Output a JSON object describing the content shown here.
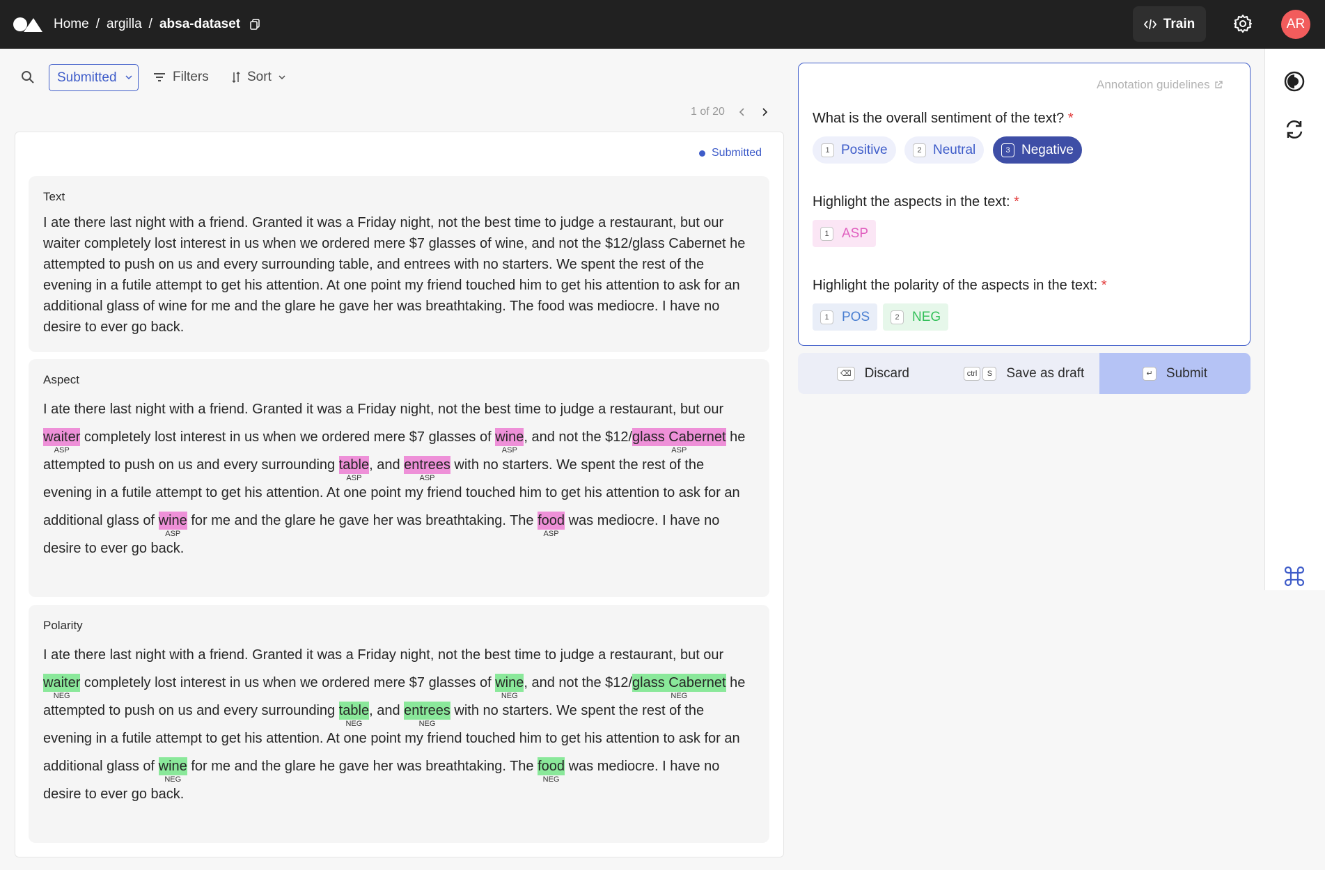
{
  "header": {
    "breadcrumbs": [
      "Home",
      "argilla",
      "absa-dataset"
    ],
    "separator": "/",
    "train_label": "Train",
    "avatar_initials": "AR"
  },
  "toolbar": {
    "status_filter": "Submitted",
    "filters_label": "Filters",
    "sort_label": "Sort",
    "pagination": "1 of 20"
  },
  "record": {
    "status": "Submitted",
    "fields": [
      {
        "label": "Text",
        "text": "I ate there last night with a friend. Granted it was a Friday night, not the best time to judge a restaurant, but our waiter completely lost interest in us when we ordered mere $7 glasses of wine, and not the $12/glass Cabernet he attempted to push on us and every surrounding table, and entrees with no starters. We spent the rest of the evening in a futile attempt to get his attention. At one point my friend touched him to get his attention to ask for an additional glass of wine for me and the glare he gave her was breathtaking. The food was mediocre. I have no desire to ever go back."
      },
      {
        "label": "Aspect",
        "segments": [
          {
            "t": "I ate there last night with a friend. Granted it was a Friday night, not the best time to judge a restaurant, but our "
          },
          {
            "t": "waiter",
            "label": "ASP"
          },
          {
            "t": " completely lost interest in us when we ordered mere $7 glasses of "
          },
          {
            "t": "wine",
            "label": "ASP"
          },
          {
            "t": ", and not the $12/"
          },
          {
            "t": "glass Cabernet",
            "label": "ASP"
          },
          {
            "t": " he attempted to push on us and every surrounding "
          },
          {
            "t": "table",
            "label": "ASP"
          },
          {
            "t": ", and "
          },
          {
            "t": "entrees",
            "label": "ASP"
          },
          {
            "t": " with no starters. We spent the rest of the evening in a futile attempt to get his attention. At one point my friend touched him to get his attention to ask for an additional glass of "
          },
          {
            "t": "wine",
            "label": "ASP"
          },
          {
            "t": " for me and the glare he gave her was breathtaking. The "
          },
          {
            "t": "food",
            "label": "ASP"
          },
          {
            "t": " was mediocre. I have no desire to ever go back."
          }
        ]
      },
      {
        "label": "Polarity",
        "segments": [
          {
            "t": "I ate there last night with a friend. Granted it was a Friday night, not the best time to judge a restaurant, but our "
          },
          {
            "t": "waiter",
            "label": "NEG"
          },
          {
            "t": " completely lost interest in us when we ordered mere $7 glasses of "
          },
          {
            "t": "wine",
            "label": "NEG"
          },
          {
            "t": ", and not the $12/"
          },
          {
            "t": "glass Cabernet",
            "label": "NEG"
          },
          {
            "t": " he attempted to push on us and every surrounding "
          },
          {
            "t": "table",
            "label": "NEG"
          },
          {
            "t": ", and "
          },
          {
            "t": "entrees",
            "label": "NEG"
          },
          {
            "t": " with no starters. We spent the rest of the evening in a futile attempt to get his attention. At one point my friend touched him to get his attention to ask for an additional glass of "
          },
          {
            "t": "wine",
            "label": "NEG"
          },
          {
            "t": " for me and the glare he gave her was breathtaking. The "
          },
          {
            "t": "food",
            "label": "NEG"
          },
          {
            "t": " was mediocre. I have no desire to ever go back."
          }
        ]
      }
    ]
  },
  "questions": {
    "guidelines_label": "Annotation guidelines",
    "required_mark": "*",
    "sentiment": {
      "title": "What is the overall sentiment of the text?",
      "options": [
        {
          "key": "1",
          "label": "Positive"
        },
        {
          "key": "2",
          "label": "Neutral"
        },
        {
          "key": "3",
          "label": "Negative"
        }
      ],
      "selected": "Negative"
    },
    "aspects": {
      "title": "Highlight the aspects in the text:",
      "labels": [
        {
          "key": "1",
          "label": "ASP"
        }
      ]
    },
    "polarity": {
      "title": "Highlight the polarity of the aspects in the text:",
      "labels": [
        {
          "key": "1",
          "label": "POS"
        },
        {
          "key": "2",
          "label": "NEG"
        }
      ]
    }
  },
  "actions": {
    "discard": {
      "key": "⌫",
      "label": "Discard"
    },
    "draft": {
      "keys": [
        "ctrl",
        "S"
      ],
      "label": "Save as draft"
    },
    "submit": {
      "key": "↵",
      "label": "Submit"
    }
  },
  "colors": {
    "accent": "#3e5cc9",
    "aspect_highlight": "#ee90d8",
    "aspect_label_text": "#e05fbf",
    "neg_highlight": "#8ae89a",
    "neg_label_text": "#34c05a",
    "pos_label_text": "#4a7fd1",
    "required": "#e23a3a"
  }
}
